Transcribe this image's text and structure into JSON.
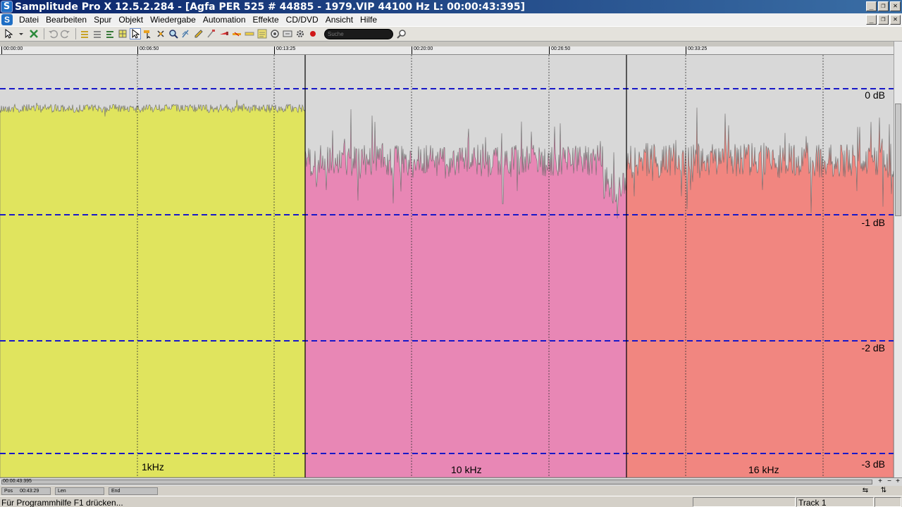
{
  "window": {
    "title": "Samplitude Pro X 12.5.2.284 - [Agfa PER 525 # 44885 - 1979.VIP   44100 Hz L: 00:00:43:395]",
    "app_icon": "S",
    "buttons": {
      "minimize": "_",
      "restore": "❐",
      "close": "✕"
    }
  },
  "menu": {
    "logo": "S",
    "items": [
      {
        "label": "Datei"
      },
      {
        "label": "Bearbeiten"
      },
      {
        "label": "Spur"
      },
      {
        "label": "Objekt"
      },
      {
        "label": "Wiedergabe"
      },
      {
        "label": "Automation"
      },
      {
        "label": "Effekte"
      },
      {
        "label": "CD/DVD"
      },
      {
        "label": "Ansicht"
      },
      {
        "label": "Hilfe"
      }
    ]
  },
  "toolbar": {
    "search_placeholder": "Suche",
    "icons": [
      "pointer-icon",
      "dropdown-icon",
      "close-x-icon",
      "undo-icon",
      "redo-icon",
      "list-icon",
      "list2-icon",
      "align-icon",
      "grid-icon",
      "select-tool-icon",
      "range-tool-icon",
      "zoom-tool-icon",
      "cut-tool-icon",
      "pencil-tool-icon",
      "eraser-tool-icon",
      "knife-tool-icon",
      "scissors-tool-icon",
      "marker-icon",
      "clip-icon",
      "loop-icon",
      "scrub-icon",
      "settings-gear-icon",
      "record-icon"
    ]
  },
  "ruler": {
    "ticks": [
      "00:00:00",
      "00:06:50",
      "00:13:25",
      "00:20:00",
      "00:26:50",
      "00:33:25"
    ]
  },
  "track": {
    "db_labels": [
      "0 dB",
      "-1 dB",
      "-2 dB",
      "-3 dB"
    ],
    "objects": [
      {
        "label": "1kHz",
        "color": "#e0e45e"
      },
      {
        "label": "10 kHz",
        "color": "#e887b5"
      },
      {
        "label": "16 kHz",
        "color": "#f18680"
      }
    ],
    "background": "#d8d8d8",
    "guide_color": "#1818c8"
  },
  "hscroll": {
    "position": "00:00:43:395"
  },
  "posbar": {
    "pos_label": "Pos",
    "pos_value": "00:43:29",
    "len_label": "Len",
    "end_label": "End"
  },
  "status": {
    "help_text": "Für Programmhilfe F1 drücken...",
    "track": "Track 1"
  }
}
